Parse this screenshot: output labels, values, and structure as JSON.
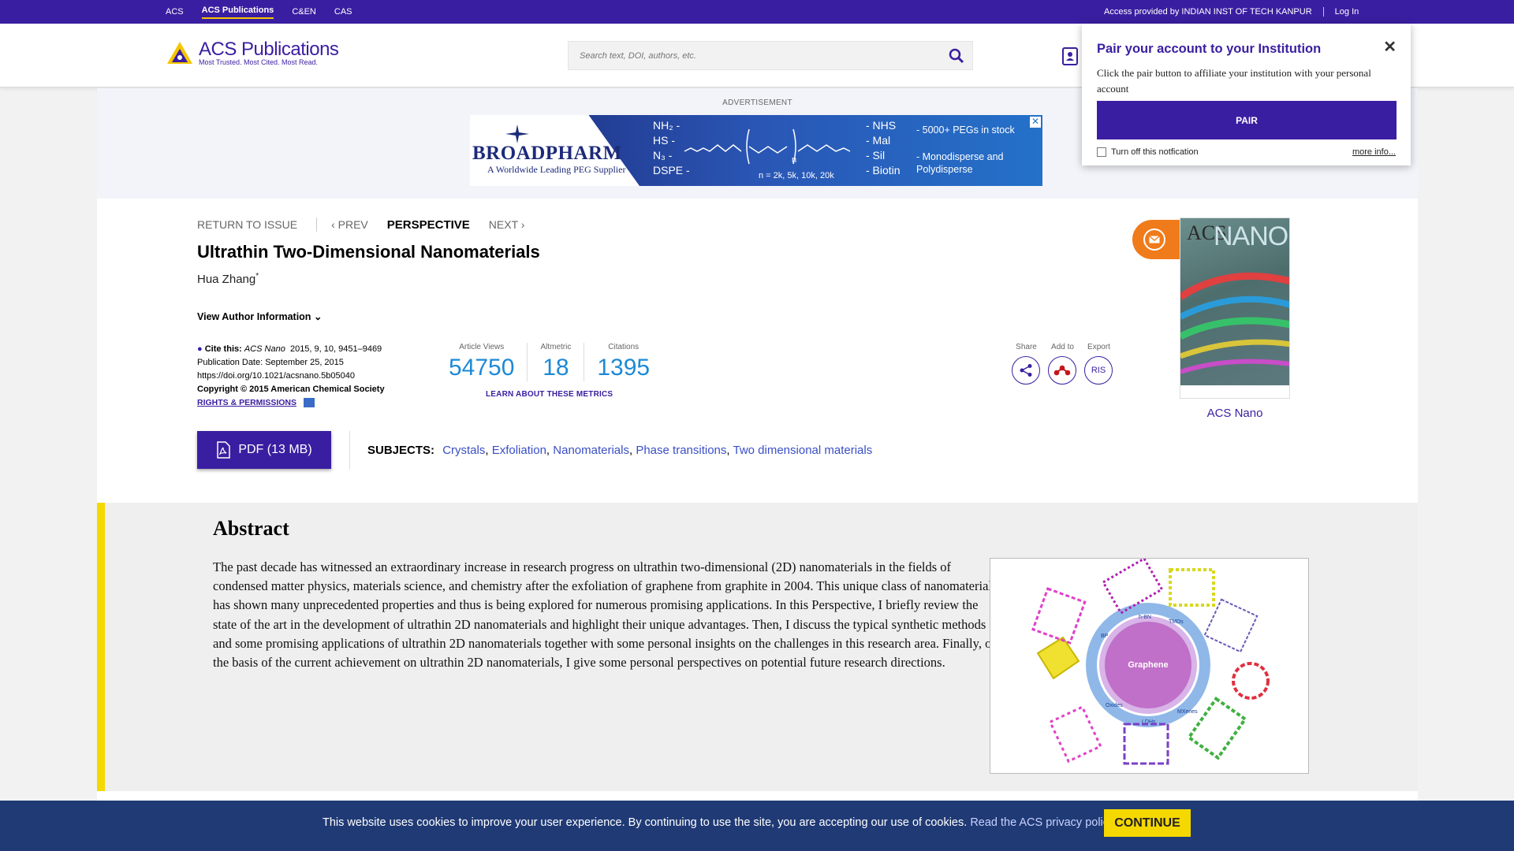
{
  "topbar": {
    "links": [
      "ACS",
      "ACS Publications",
      "C&EN",
      "CAS"
    ],
    "active_link": "ACS Publications",
    "access_text": "Access provided by INDIAN INST OF TECH KANPUR",
    "login": "Log In"
  },
  "header": {
    "logo_name": "ACS Publications",
    "logo_tagline": "Most Trusted. Most Cited. Most Read.",
    "search_placeholder": "Search text, DOI, authors, etc."
  },
  "ad": {
    "label": "ADVERTISEMENT",
    "brand": "BROADPHARM",
    "brand_sub": "A Worldwide Leading PEG Supplier",
    "left_groups": [
      "NH₂ -",
      "HS -",
      "N₃ -",
      "DSPE -"
    ],
    "right_groups": [
      "- NHS",
      "- Mal",
      "- Sil",
      "- Biotin"
    ],
    "n_label": "n",
    "n_values": "n = 2k, 5k, 10k, 20k",
    "feature1": "- 5000+ PEGs in stock",
    "feature2": "- Monodisperse and Polydisperse"
  },
  "article": {
    "nav": {
      "return": "RETURN TO ISSUE",
      "prev": "PREV",
      "current": "PERSPECTIVE",
      "next": "NEXT"
    },
    "title": "Ultrathin Two-Dimensional Nanomaterials",
    "author": "Hua Zhang",
    "author_mark": "*",
    "view_author": "View Author Information",
    "cite_label": "Cite this:",
    "cite_journal": "ACS Nano",
    "cite_ref": "2015, 9, 10, 9451–9469",
    "pub_date": "Publication Date: September 25, 2015",
    "doi": "https://doi.org/10.1021/acsnano.5b05040",
    "copyright": "Copyright © 2015 American Chemical Society",
    "rights": "RIGHTS & PERMISSIONS",
    "metrics": [
      {
        "label": "Article Views",
        "value": "54750"
      },
      {
        "label": "Altmetric",
        "value": "18"
      },
      {
        "label": "Citations",
        "value": "1395"
      }
    ],
    "learn_metrics": "LEARN ABOUT THESE METRICS",
    "tools": [
      {
        "label": "Share",
        "icon": "share-icon"
      },
      {
        "label": "Add to",
        "icon": "mendeley-icon"
      },
      {
        "label": "Export",
        "icon": "RIS"
      }
    ],
    "pdf_label": "PDF (13 MB)",
    "subjects_label": "SUBJECTS:",
    "subjects": [
      "Crystals",
      "Exfoliation",
      "Nanomaterials",
      "Phase transitions",
      "Two dimensional materials"
    ],
    "journal_caption": "ACS Nano",
    "cover_title_a": "ACS",
    "cover_title_b": "NANO"
  },
  "abstract": {
    "heading": "Abstract",
    "text": "The past decade has witnessed an extraordinary increase in research progress on ultrathin two-dimensional (2D) nanomaterials in the fields of condensed matter physics, materials science, and chemistry after the exfoliation of graphene from graphite in 2004. This unique class of nanomaterials has shown many unprecedented properties and thus is being explored for numerous promising applications. In this Perspective, I briefly review the state of the art in the development of ultrathin 2D nanomaterials and highlight their unique advantages. Then, I discuss the typical synthetic methods and some promising applications of ultrathin 2D nanomaterials together with some personal insights on the challenges in this research area. Finally, on the basis of the current achievement on ultrathin 2D nanomaterials, I give some personal perspectives on potential future research directions.",
    "toc_center_label": "Graphene",
    "toc_ring_labels": [
      "h-BN",
      "TMDs",
      "LDHs",
      "MXenes",
      "Oxides",
      "BP"
    ]
  },
  "popup": {
    "title": "Pair your account to your Institution",
    "description": "Click the pair button to affiliate your institution with your personal account",
    "pair_button": "PAIR",
    "turn_off": "Turn off this notfication",
    "more_info": "more info..."
  },
  "cookie": {
    "text": "This website uses cookies to improve your user experience. By continuing to use the site, you are accepting our use of cookies.",
    "link": "Read the ACS privacy policy",
    "continue": "CONTINUE"
  },
  "colors": {
    "brand_purple": "#3a1ea1",
    "metric_blue": "#1d89d6",
    "abstract_accent": "#f5d800",
    "cookie_bg": "#203a75",
    "mail_orange": "#f07b1a"
  }
}
